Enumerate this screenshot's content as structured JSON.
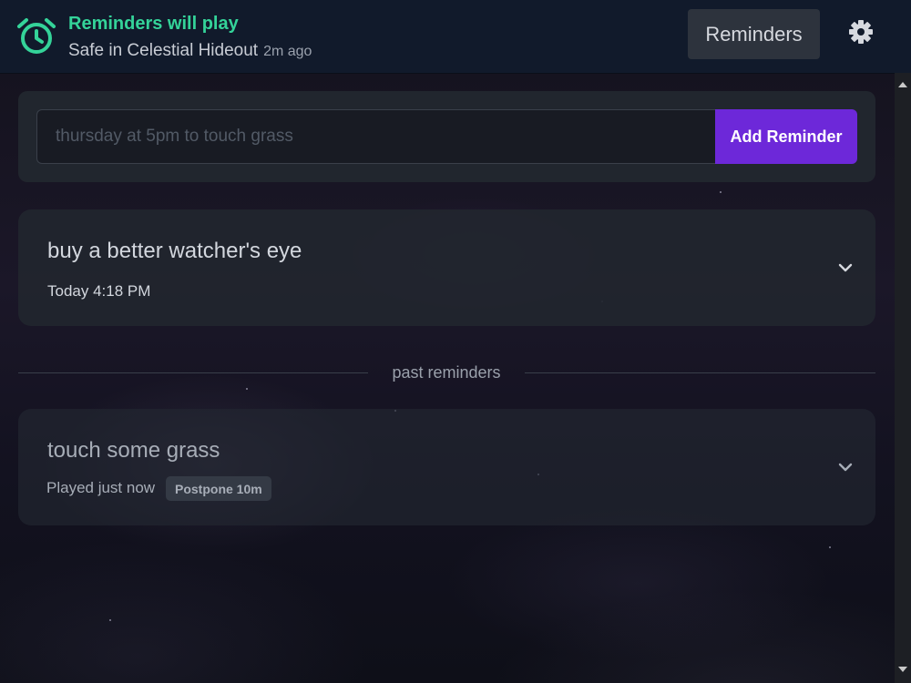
{
  "header": {
    "status_title": "Reminders will play",
    "status_subtitle": "Safe in Celestial Hideout",
    "status_time": "2m ago",
    "reminders_button": "Reminders",
    "accent_color": "#34d399"
  },
  "input": {
    "placeholder": "thursday at 5pm to touch grass",
    "value": "",
    "add_button": "Add Reminder",
    "add_button_color": "#6d28d9"
  },
  "upcoming": [
    {
      "title": "buy a better watcher's eye",
      "time": "Today 4:18 PM"
    }
  ],
  "past_label": "past reminders",
  "past": [
    {
      "title": "touch some grass",
      "status": "Played just now",
      "action": "Postpone 10m"
    }
  ],
  "icons": {
    "alarm": "alarm-clock-icon",
    "settings": "gear-icon",
    "expand": "chevron-down-icon"
  }
}
